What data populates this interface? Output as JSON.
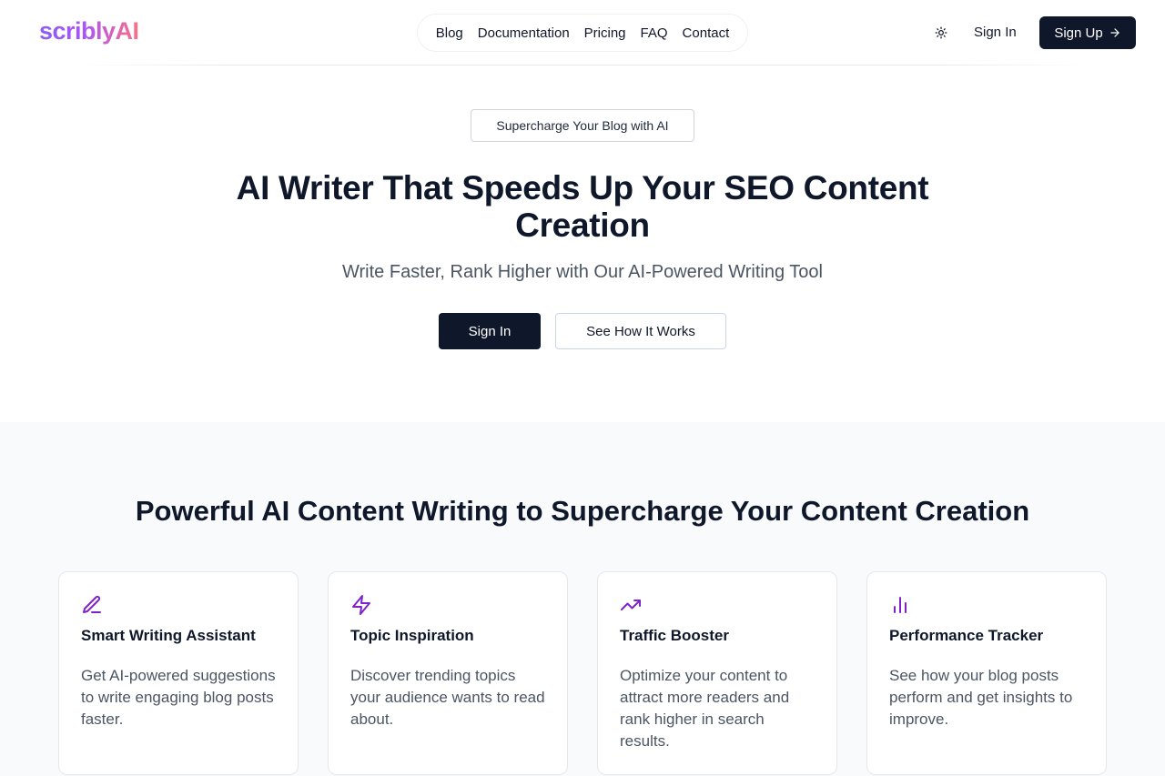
{
  "header": {
    "logo": "scriblyAI",
    "nav": [
      {
        "label": "Blog"
      },
      {
        "label": "Documentation"
      },
      {
        "label": "Pricing"
      },
      {
        "label": "FAQ"
      },
      {
        "label": "Contact"
      }
    ],
    "theme_icon": "sun-icon",
    "signin_label": "Sign In",
    "signup_label": "Sign Up",
    "signup_icon": "arrow-right-icon"
  },
  "hero": {
    "badge": "Supercharge Your Blog with AI",
    "title": "AI Writer That Speeds Up Your SEO Content Creation",
    "subtitle": "Write Faster, Rank Higher with Our AI-Powered Writing Tool",
    "primary_button": "Sign In",
    "secondary_button": "See How It Works"
  },
  "features": {
    "title": "Powerful AI Content Writing to Supercharge Your Content Creation",
    "cards": [
      {
        "icon": "pencil-icon",
        "title": "Smart Writing Assistant",
        "description": "Get AI-powered suggestions to write engaging blog posts faster."
      },
      {
        "icon": "lightning-icon",
        "title": "Topic Inspiration",
        "description": "Discover trending topics your audience wants to read about."
      },
      {
        "icon": "trending-up-icon",
        "title": "Traffic Booster",
        "description": "Optimize your content to attract more readers and rank higher in search results."
      },
      {
        "icon": "bar-chart-icon",
        "title": "Performance Tracker",
        "description": "See how your blog posts perform and get insights to improve."
      }
    ]
  },
  "colors": {
    "brand_dark": "#0f172a",
    "accent_purple": "#7e22ce",
    "logo_gradient_start": "#8b5cf6",
    "logo_gradient_end": "#fb7185",
    "muted_text": "#4b5563",
    "section_bg": "#f8fafc"
  }
}
